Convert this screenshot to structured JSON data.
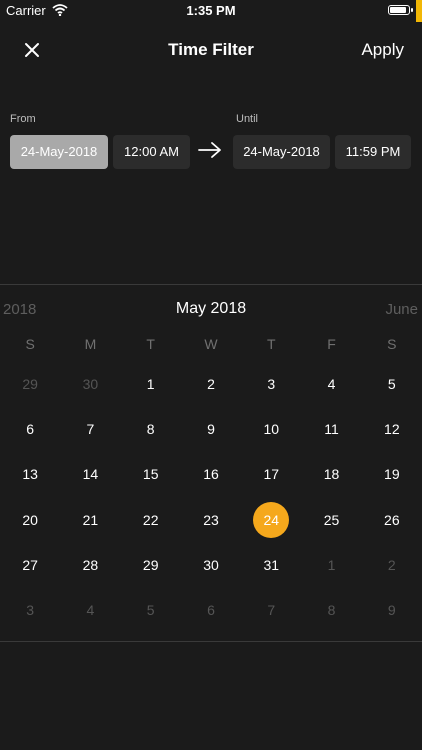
{
  "status_bar": {
    "carrier": "Carrier",
    "time": "1:35 PM"
  },
  "header": {
    "title": "Time Filter",
    "apply_label": "Apply"
  },
  "range": {
    "from_label": "From",
    "from_date": "24-May-2018",
    "from_time": "12:00 AM",
    "until_label": "Until",
    "until_date": "24-May-2018",
    "until_time": "11:59 PM"
  },
  "calendar": {
    "prev_label": "2018",
    "title": "May 2018",
    "next_label": "June",
    "weekdays": [
      "S",
      "M",
      "T",
      "W",
      "T",
      "F",
      "S"
    ],
    "weeks": [
      [
        {
          "d": "29",
          "m": true
        },
        {
          "d": "30",
          "m": true
        },
        {
          "d": "1"
        },
        {
          "d": "2"
        },
        {
          "d": "3"
        },
        {
          "d": "4"
        },
        {
          "d": "5"
        }
      ],
      [
        {
          "d": "6"
        },
        {
          "d": "7"
        },
        {
          "d": "8"
        },
        {
          "d": "9"
        },
        {
          "d": "10"
        },
        {
          "d": "11"
        },
        {
          "d": "12"
        }
      ],
      [
        {
          "d": "13"
        },
        {
          "d": "14"
        },
        {
          "d": "15"
        },
        {
          "d": "16"
        },
        {
          "d": "17"
        },
        {
          "d": "18"
        },
        {
          "d": "19"
        }
      ],
      [
        {
          "d": "20"
        },
        {
          "d": "21"
        },
        {
          "d": "22"
        },
        {
          "d": "23"
        },
        {
          "d": "24",
          "s": true
        },
        {
          "d": "25"
        },
        {
          "d": "26"
        }
      ],
      [
        {
          "d": "27"
        },
        {
          "d": "28"
        },
        {
          "d": "29"
        },
        {
          "d": "30"
        },
        {
          "d": "31"
        },
        {
          "d": "1",
          "m": true
        },
        {
          "d": "2",
          "m": true
        }
      ],
      [
        {
          "d": "3",
          "m": true
        },
        {
          "d": "4",
          "m": true
        },
        {
          "d": "5",
          "m": true
        },
        {
          "d": "6",
          "m": true
        },
        {
          "d": "7",
          "m": true
        },
        {
          "d": "8",
          "m": true
        },
        {
          "d": "9",
          "m": true
        }
      ]
    ]
  },
  "colors": {
    "accent": "#f5a81c",
    "background": "#1b1b1b",
    "chip": "#2c2c2c",
    "chip_active": "#a9a9a9"
  },
  "icons": {
    "close": "close-icon",
    "arrow": "arrow-right-icon",
    "wifi": "wifi-icon",
    "battery": "battery-icon"
  }
}
